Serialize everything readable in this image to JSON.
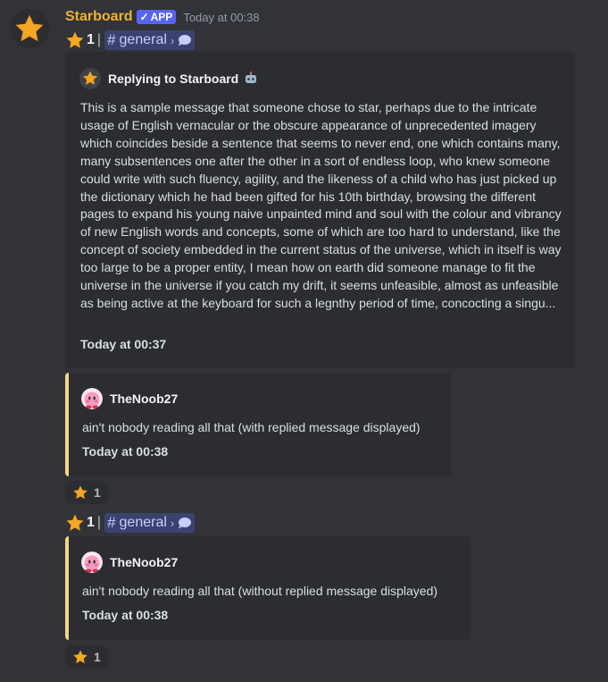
{
  "message": {
    "author": "Starboard",
    "badge": "APP",
    "timestamp": "Today at 00:38"
  },
  "star_lines": [
    {
      "count": "1",
      "channel": "general"
    },
    {
      "count": "1",
      "channel": "general"
    }
  ],
  "embed1": {
    "author": "Replying to Starboard",
    "author_icon": "robot-icon",
    "description": "This is a sample message that someone chose to star, perhaps due to the intricate usage of English vernacular or the obscure appearance of unprecedented imagery which coincides beside a sentence that seems to never end, one which contains many, many subsentences one after the other in a sort of endless loop, who knew someone could write with such fluency, agility, and the likeness of a child who has just picked up the dictionary which he had been gifted for his 10th birthday, browsing the different pages to expand his young naive unpainted mind and soul with the colour and vibrancy of new English words and concepts, some of which are too hard to understand, like the concept of society embedded in the current status of the universe, which in itself is way too large to be a proper entity, I mean how on earth did someone manage to fit the universe in the universe if you catch my drift, it seems unfeasible, almost as unfeasible as being active at the keyboard for such a legnthy period of time, concocting a singu...",
    "footer": "Today at 00:37"
  },
  "embed2": {
    "author": "TheNoob27",
    "description": "ain't nobody reading all that (with replied message displayed)",
    "footer": "Today at 00:38"
  },
  "embed3": {
    "author": "TheNoob27",
    "description": "ain't nobody reading all that (without replied message displayed)",
    "footer": "Today at 00:38"
  },
  "reactions": [
    {
      "emoji": "star-icon",
      "count": "1"
    },
    {
      "emoji": "star-icon",
      "count": "1"
    }
  ],
  "colors": {
    "accent_gold": "#f0b232",
    "embed_border": "#f0d58a",
    "mention_bg": "#3c4270",
    "app_badge": "#5865f2"
  }
}
